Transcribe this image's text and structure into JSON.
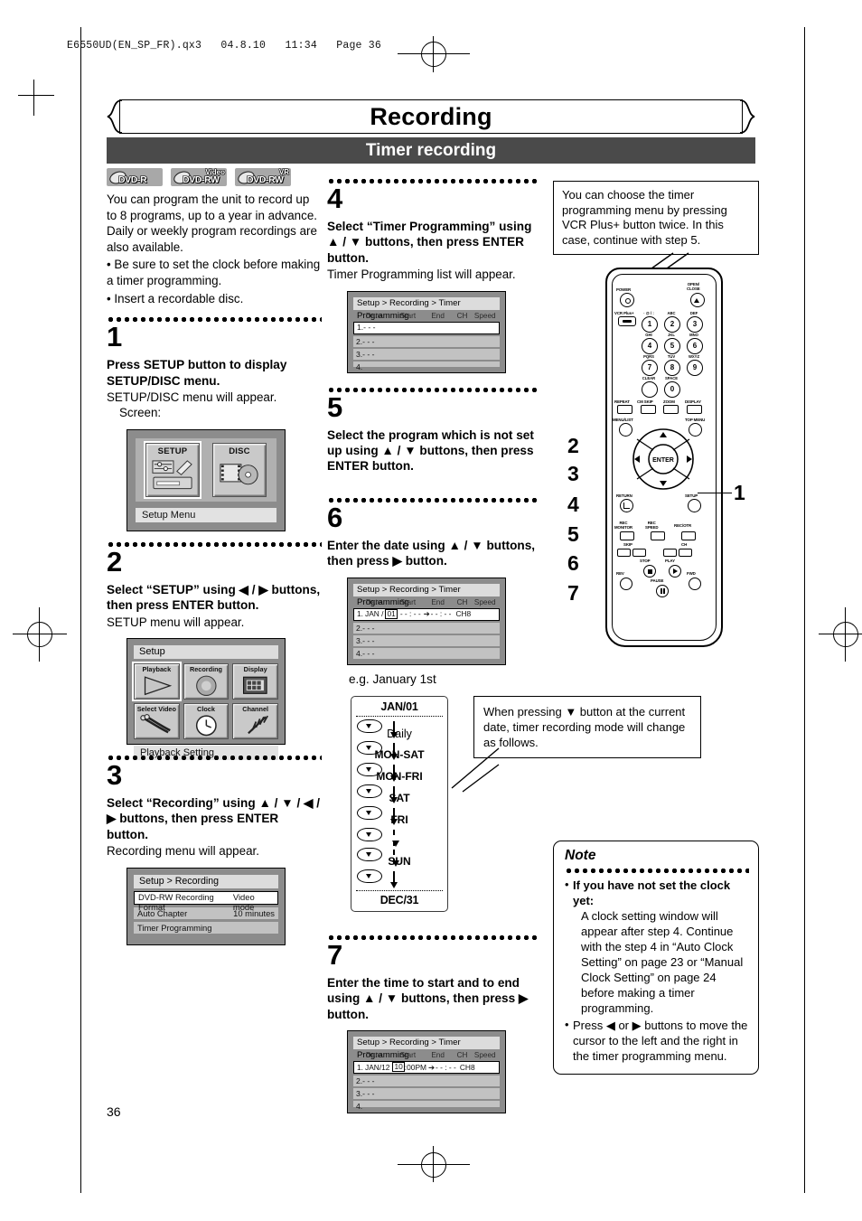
{
  "file_header": "E6550UD(EN_SP_FR).qx3   04.8.10   11:34   Page 36",
  "banner": {
    "title": "Recording",
    "subtitle": "Timer recording"
  },
  "page_number": "36",
  "badges": [
    {
      "name": "DVD-R",
      "top": ""
    },
    {
      "name": "DVD-RW",
      "top": "Video"
    },
    {
      "name": "DVD-RW",
      "top": "VR"
    }
  ],
  "intro": {
    "paragraph": "You can program the unit to record up to 8 programs, up to a year in advance. Daily or weekly program recordings are also available.",
    "bullets": [
      "Be sure to set the clock before making a timer programming.",
      "Insert a recordable disc."
    ]
  },
  "steps": {
    "s1": {
      "number": "1",
      "instruction": "Press SETUP button to display SETUP/DISC menu.",
      "sub": "SETUP/DISC menu will appear.",
      "screen_label": "Screen:"
    },
    "s2": {
      "number": "2",
      "instruction": "Select “SETUP” using ◀ / ▶ buttons, then press ENTER button.",
      "sub": "SETUP menu will appear."
    },
    "s3": {
      "number": "3",
      "instruction": "Select “Recording” using ▲ / ▼ / ◀ / ▶ buttons, then press ENTER button.",
      "sub": "Recording menu will appear."
    },
    "s4": {
      "number": "4",
      "instruction": "Select “Timer Programming” using ▲ / ▼ buttons, then press ENTER button.",
      "sub": "Timer Programming list will appear."
    },
    "s5": {
      "number": "5",
      "instruction": "Select the program which is not set up using ▲ / ▼ buttons, then press ENTER button."
    },
    "s6": {
      "number": "6",
      "instruction": "Enter the date using ▲ / ▼ buttons, then press ▶ button.",
      "example": "e.g. January 1st"
    },
    "s7": {
      "number": "7",
      "instruction": "Enter the time to start and to end using ▲ / ▼ buttons, then press ▶ button."
    }
  },
  "osd_setup_disc": {
    "icons": [
      {
        "label": "SETUP",
        "selected": true
      },
      {
        "label": "DISC",
        "selected": false
      }
    ],
    "status_bar": "Setup Menu"
  },
  "osd_setup_menu": {
    "header": "Setup",
    "icons": [
      {
        "label": "Playback",
        "selected": true
      },
      {
        "label": "Recording",
        "selected": false
      },
      {
        "label": "Display",
        "selected": false
      },
      {
        "label": "Select Video",
        "selected": false
      },
      {
        "label": "Clock",
        "selected": false
      },
      {
        "label": "Channel",
        "selected": false
      }
    ],
    "status_bar": "Playback Setting"
  },
  "osd_recording": {
    "header": "Setup > Recording",
    "rows": [
      {
        "label": "DVD-RW Recording Format",
        "value": "Video mode",
        "selected": true
      },
      {
        "label": "Auto Chapter",
        "value": "10 minutes",
        "selected": false
      },
      {
        "label": "Timer Programming",
        "value": "",
        "selected": false
      }
    ]
  },
  "osd_timer_list": {
    "header": "Setup > Recording > Timer Programming",
    "columns": [
      "Date",
      "Start",
      "End",
      "CH",
      "Speed"
    ],
    "rows_empty": [
      "1.- - -",
      "2.- - -",
      "3.- - -",
      "4."
    ]
  },
  "osd_timer_date": {
    "header": "Setup > Recording > Timer Programming",
    "columns": [
      "Date",
      "Start",
      "End",
      "CH",
      "Speed"
    ],
    "row1": {
      "index": "1.",
      "month": "JAN /",
      "day_boxed": "01",
      "start": "- - : - -",
      "arrow": "➔",
      "end": "- - : - -",
      "ch": "CH8",
      "speed": ""
    },
    "rows_empty": [
      "2.- - -",
      "3.- - -",
      "4.- - -"
    ]
  },
  "osd_timer_time": {
    "header": "Setup > Recording > Timer Programming",
    "columns": [
      "Date",
      "Start",
      "End",
      "CH",
      "Speed"
    ],
    "row1": {
      "index": "1.",
      "date": "JAN/12",
      "hour_boxed": "10",
      "start_rest": ":00PM",
      "arrow": "➔",
      "end": "- - : - -",
      "ch": "CH8",
      "speed": ""
    },
    "rows_empty": [
      "2.- - -",
      "3.- - -",
      "4."
    ]
  },
  "date_cycle": {
    "top": "JAN/01",
    "items": [
      "Daily",
      "MON-SAT",
      "MON-FRI",
      "SAT",
      "FRI",
      "",
      "SUN"
    ],
    "bottom": "DEC/31"
  },
  "callouts": {
    "vcr_plus": "You can choose the timer programming menu by pressing VCR Plus+ button twice. In this case, continue with step 5.",
    "down_button": "When pressing ▼ button at the current date, timer recording mode will change as follows."
  },
  "note": {
    "title": "Note",
    "items": [
      {
        "bold": "If you have not set the clock yet:",
        "text": "A clock setting window will appear after step 4.  Continue with the step 4 in “Auto Clock Setting” on page 23 or “Manual Clock Setting” on page 24 before making a timer programming."
      },
      {
        "bold": "",
        "text": "Press ◀ or ▶ buttons to move the cursor to the left and the right in the timer programming menu."
      }
    ]
  },
  "remote": {
    "callout_numbers": [
      "2",
      "3",
      "4",
      "5",
      "6",
      "7",
      "1"
    ],
    "buttons": [
      "POWER",
      "OPEN/ CLOSE",
      "VCR Plus+",
      "CLEAR",
      "SPACE",
      "REPEAT",
      "CM SKIP",
      "ZOOM",
      "DISPLAY",
      "MENU/LIST",
      "TOP MENU",
      "RETURN",
      "SETUP",
      "ENTER",
      "REC MONITOR",
      "REC SPEED",
      "REC/OTR",
      "SKIP",
      "CH",
      "STOP",
      "PLAY",
      "REV",
      "FWD",
      "PAUSE"
    ],
    "keypad": [
      {
        "digit": "1",
        "letters": "· @ / :"
      },
      {
        "digit": "2",
        "letters": "ABC"
      },
      {
        "digit": "3",
        "letters": "DEF"
      },
      {
        "digit": "4",
        "letters": "GHI"
      },
      {
        "digit": "5",
        "letters": "JKL"
      },
      {
        "digit": "6",
        "letters": "MNO"
      },
      {
        "digit": "7",
        "letters": "PQRS"
      },
      {
        "digit": "8",
        "letters": "TUV"
      },
      {
        "digit": "9",
        "letters": "WXYZ"
      },
      {
        "digit": "0",
        "letters": "SPACE"
      }
    ]
  }
}
